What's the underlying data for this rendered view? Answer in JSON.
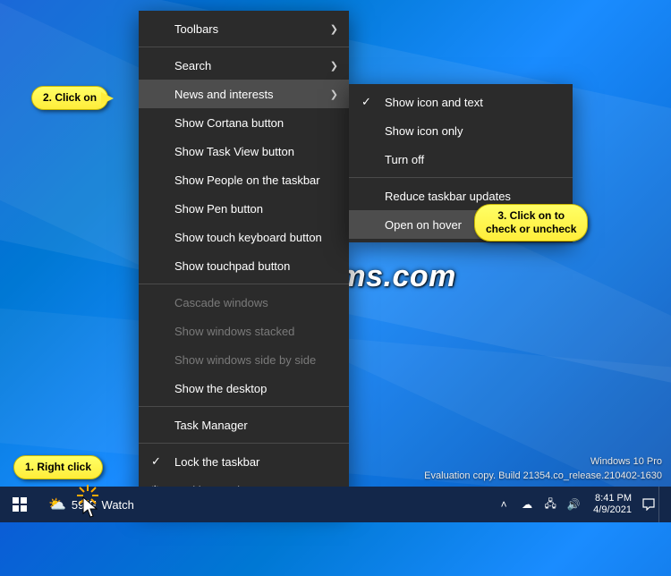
{
  "callouts": {
    "c1": "1. Right click",
    "c2": "2. Click on",
    "c3": "3. Click on to\ncheck or uncheck"
  },
  "menu1": {
    "toolbars": "Toolbars",
    "search": "Search",
    "news": "News and interests",
    "cortana": "Show Cortana button",
    "taskview": "Show Task View button",
    "people": "Show People on the taskbar",
    "pen": "Show Pen button",
    "touchkb": "Show touch keyboard button",
    "touchpad": "Show touchpad button",
    "cascade": "Cascade windows",
    "stacked": "Show windows stacked",
    "sidebyside": "Show windows side by side",
    "showdesktop": "Show the desktop",
    "taskmgr": "Task Manager",
    "lock": "Lock the taskbar",
    "settings": "Taskbar settings"
  },
  "menu2": {
    "icontext": "Show icon and text",
    "icononly": "Show icon only",
    "turnoff": "Turn off",
    "reduce": "Reduce taskbar updates",
    "hover": "Open on hover"
  },
  "weather": {
    "temp": "59°F",
    "label": "Watch"
  },
  "clock": {
    "time": "8:41 PM",
    "date": "4/9/2021"
  },
  "buildinfo": {
    "edition": "Windows 10 Pro",
    "build": "Evaluation copy. Build 21354.co_release.210402-1630"
  },
  "watermark": "TenForums.com"
}
